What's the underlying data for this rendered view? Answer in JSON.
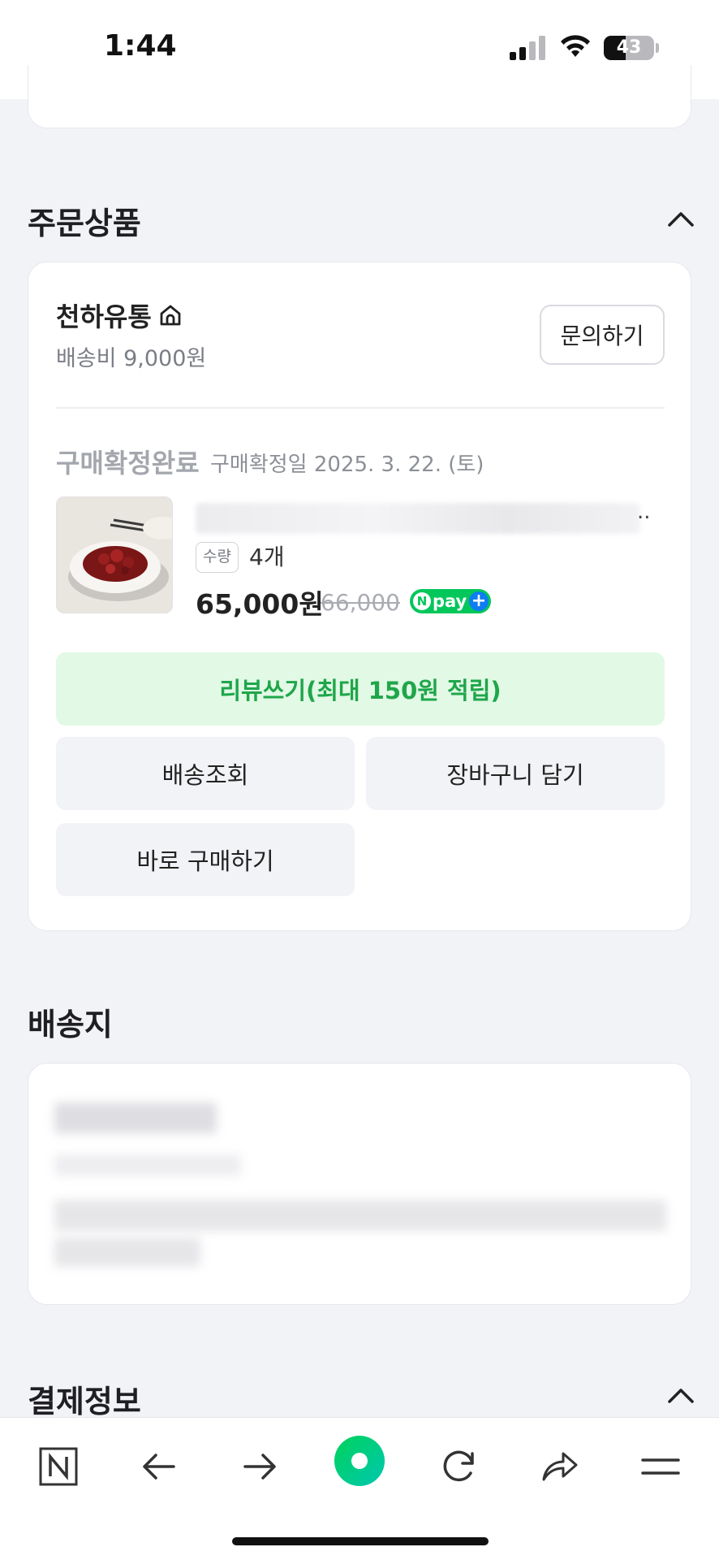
{
  "status_bar": {
    "time": "1:44",
    "battery": "43",
    "battery_level_percent": 43
  },
  "order_section": {
    "title": "주문상품",
    "seller": {
      "name": "천하유통",
      "shipping_fee": "배송비 9,000원",
      "inquiry_label": "문의하기"
    },
    "item": {
      "status": "구매확정완료",
      "confirm_date": "구매확정일 2025. 3. 22. (토)",
      "name_ellipsis": "..",
      "qty_label": "수량",
      "qty_value": "4개",
      "price": "65,000원",
      "original_price": "66,000",
      "npay_badge": "pay"
    },
    "buttons": {
      "review": "리뷰쓰기(최대 150원 적립)",
      "track": "배송조회",
      "cart": "장바구니 담기",
      "buy_now": "바로 구매하기"
    }
  },
  "address_section": {
    "title": "배송지"
  },
  "payment_section": {
    "title": "결제정보"
  },
  "tab_bar": {
    "icons": [
      "naver-logo-icon",
      "back-arrow-icon",
      "forward-arrow-icon",
      "green-dot-icon",
      "reload-icon",
      "share-icon",
      "menu-icon"
    ]
  },
  "colors": {
    "accent_green": "#03c75a",
    "review_text": "#1fa64a",
    "review_bg": "#e1f9e5",
    "page_bg": "#f2f3f6"
  }
}
